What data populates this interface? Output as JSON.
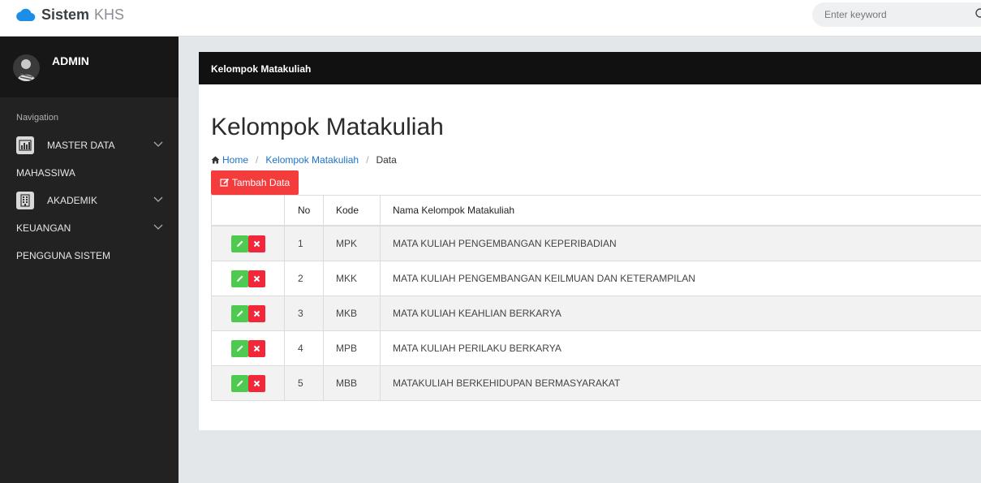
{
  "brand": {
    "name_strong": "Sistem",
    "name_light": "KHS"
  },
  "search": {
    "placeholder": "Enter keyword"
  },
  "user": {
    "name": "ADMIN"
  },
  "sidebar": {
    "heading": "Navigation",
    "items": [
      {
        "label": "MASTER DATA",
        "icon": "chart-icon",
        "has_children": true
      },
      {
        "label": "MAHASSIWA",
        "has_children": false
      },
      {
        "label": "AKADEMIK",
        "icon": "building-icon",
        "has_children": true
      },
      {
        "label": "KEUANGAN",
        "has_children": true
      },
      {
        "label": "PENGGUNA SISTEM",
        "has_children": false
      }
    ]
  },
  "card": {
    "header_title": "Kelompok Matakuliah",
    "page_title": "Kelompok Matakuliah",
    "breadcrumb": {
      "home": "Home",
      "section": "Kelompok Matakuliah",
      "current": "Data"
    },
    "add_button": "Tambah Data"
  },
  "table": {
    "columns": [
      "",
      "No",
      "Kode",
      "Nama Kelompok Matakuliah"
    ],
    "rows": [
      {
        "no": "1",
        "kode": "MPK",
        "nama": "MATA KULIAH PENGEMBANGAN KEPERIBADIAN"
      },
      {
        "no": "2",
        "kode": "MKK",
        "nama": "MATA KULIAH PENGEMBANGAN KEILMUAN DAN KETERAMPILAN"
      },
      {
        "no": "3",
        "kode": "MKB",
        "nama": "MATA KULIAH KEAHLIAN BERKARYA"
      },
      {
        "no": "4",
        "kode": "MPB",
        "nama": "MATA KULIAH PERILAKU BERKARYA"
      },
      {
        "no": "5",
        "kode": "MBB",
        "nama": "MATAKULIAH BERKEHIDUPAN BERMASYARAKAT"
      }
    ]
  },
  "colors": {
    "accent_red": "#f43c3c",
    "edit_green": "#4ecb4e",
    "delete_red": "#f2283a",
    "link_blue": "#1a73c9",
    "brand_blue": "#1b8fe8"
  }
}
